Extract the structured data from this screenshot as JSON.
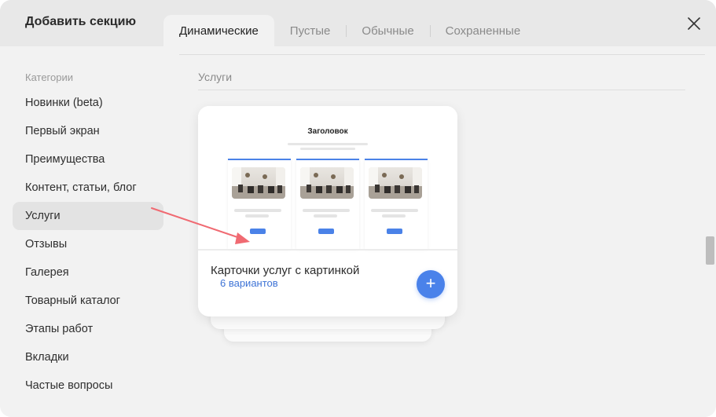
{
  "modal": {
    "title": "Добавить секцию",
    "tabs": [
      {
        "label": "Динамические",
        "active": true
      },
      {
        "label": "Пустые",
        "active": false
      },
      {
        "label": "Обычные",
        "active": false
      },
      {
        "label": "Сохраненные",
        "active": false
      }
    ],
    "close_icon": "close-icon"
  },
  "sidebar": {
    "heading": "Категории",
    "items": [
      {
        "label": "Новинки (beta)",
        "active": false
      },
      {
        "label": "Первый экран",
        "active": false
      },
      {
        "label": "Преимущества",
        "active": false
      },
      {
        "label": "Контент, статьи, блог",
        "active": false
      },
      {
        "label": "Услуги",
        "active": true
      },
      {
        "label": "Отзывы",
        "active": false
      },
      {
        "label": "Галерея",
        "active": false
      },
      {
        "label": "Товарный каталог",
        "active": false
      },
      {
        "label": "Этапы работ",
        "active": false
      },
      {
        "label": "Вкладки",
        "active": false
      },
      {
        "label": "Частые вопросы",
        "active": false
      }
    ]
  },
  "content": {
    "section_label": "Услуги",
    "card": {
      "title": "Карточки услуг с картинкой",
      "variants": "6 вариантов",
      "add_icon": "plus-icon",
      "add_label": "+",
      "preview": {
        "heading": "Заголовок",
        "columns": 3
      }
    }
  },
  "colors": {
    "accent": "#4a82ea",
    "link": "#3f74d6",
    "annotation_arrow": "#f06a72",
    "active_item_bg": "#e3e3e3"
  }
}
